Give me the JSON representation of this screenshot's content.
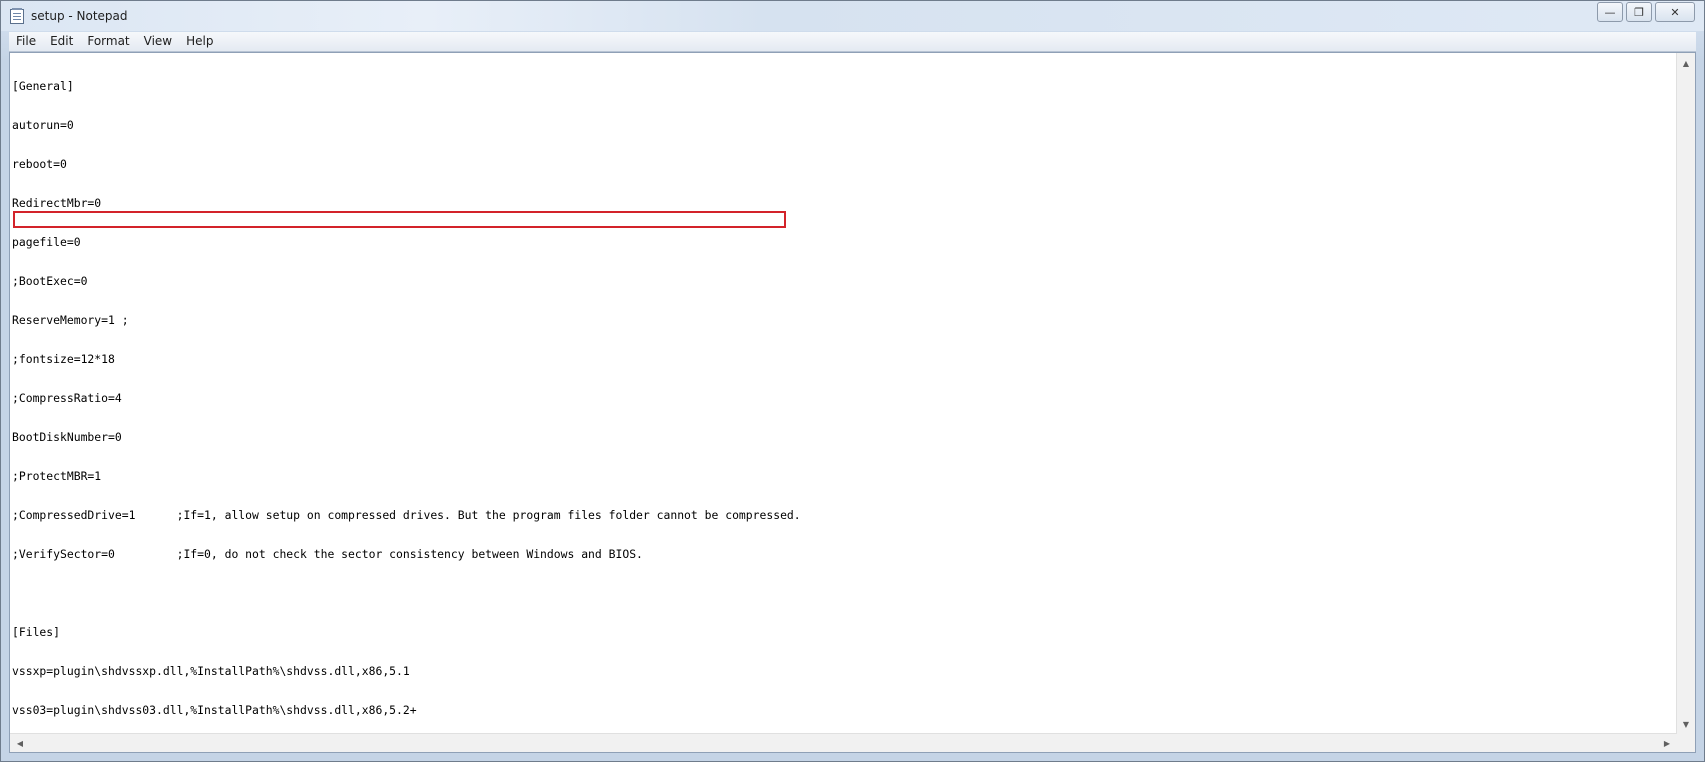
{
  "window": {
    "title": "setup - Notepad",
    "minimize_glyph": "—",
    "restore_glyph": "❐",
    "close_glyph": "✕"
  },
  "menu": [
    {
      "label": "File"
    },
    {
      "label": "Edit"
    },
    {
      "label": "Format"
    },
    {
      "label": "View"
    },
    {
      "label": "Help"
    }
  ],
  "document": {
    "lines": [
      "[General]",
      "autorun=0",
      "reboot=0",
      "RedirectMbr=0",
      "pagefile=0",
      ";BootExec=0",
      "ReserveMemory=1 ;",
      ";fontsize=12*18",
      ";CompressRatio=4",
      "BootDiskNumber=0",
      ";ProtectMBR=1",
      ";CompressedDrive=1      ;If=1, allow setup on compressed drives. But the program files folder cannot be compressed.",
      ";VerifySector=0         ;If=0, do not check the sector consistency between Windows and BIOS.",
      "",
      "[Files]",
      "vssxp=plugin\\shdvssxp.dll,%InstallPath%\\shdvss.dll,x86,5.1",
      "vss03=plugin\\shdvss03.dll,%InstallPath%\\shdvss.dll,x86,5.2+"
    ],
    "highlighted_line": 12,
    "highlight_color": "#d3232a"
  },
  "scrollbars": {
    "up_arrow": "▲",
    "down_arrow": "▼",
    "left_arrow": "◀",
    "right_arrow": "▶"
  }
}
